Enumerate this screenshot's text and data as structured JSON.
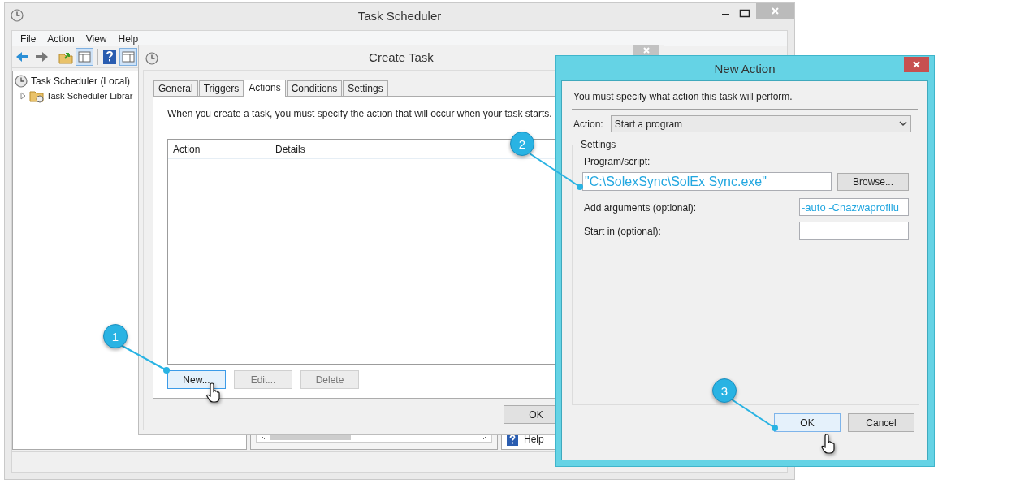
{
  "main_window": {
    "title": "Task Scheduler",
    "menu": [
      "File",
      "Action",
      "View",
      "Help"
    ],
    "tree": [
      {
        "label": "Task Scheduler (Local)",
        "children": [
          {
            "label": "Task Scheduler Librar",
            "expanded": false
          }
        ]
      }
    ],
    "actions_pane": {
      "items": [
        "Help"
      ]
    }
  },
  "create_task": {
    "title": "Create Task",
    "tabs": [
      {
        "label": "General",
        "selected": false
      },
      {
        "label": "Triggers",
        "selected": false
      },
      {
        "label": "Actions",
        "selected": true
      },
      {
        "label": "Conditions",
        "selected": false
      },
      {
        "label": "Settings",
        "selected": false
      }
    ],
    "description": "When you create a task, you must specify the action that will occur when your task starts.",
    "columns": [
      "Action",
      "Details"
    ],
    "buttons": [
      {
        "label": "New...",
        "focused": true,
        "disabled": false
      },
      {
        "label": "Edit...",
        "focused": false,
        "disabled": true
      },
      {
        "label": "Delete",
        "focused": false,
        "disabled": true
      }
    ],
    "ok": "OK"
  },
  "new_action": {
    "title": "New Action",
    "description": "You must specify what action this task will perform.",
    "action_label": "Action:",
    "action_value": "Start a program",
    "group": "Settings",
    "program_label": "Program/script:",
    "program_value": "\"C:\\SolexSync\\SolEx Sync.exe\"",
    "browse": "Browse...",
    "fields": [
      {
        "label": "Add arguments (optional):",
        "value": "-auto -Cnazwaprofilu"
      },
      {
        "label": "Start in (optional):"
      }
    ],
    "buttons": [
      {
        "label": "OK",
        "focused": true
      },
      {
        "label": "Cancel",
        "focused": false
      }
    ]
  },
  "callouts": [
    {
      "number": "1"
    },
    {
      "number": "2"
    },
    {
      "number": "3"
    }
  ]
}
